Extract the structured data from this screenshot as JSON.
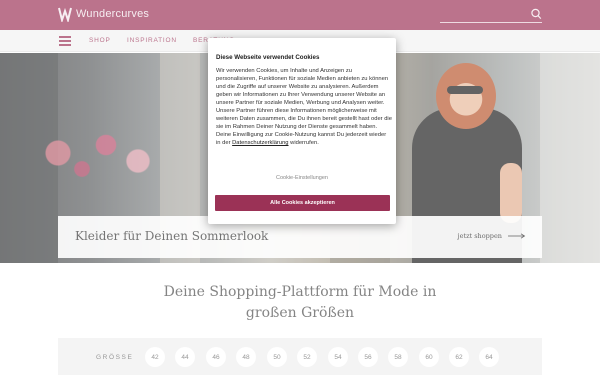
{
  "header": {
    "brand": "Wundercurves",
    "search": {
      "placeholder": "",
      "value": ""
    }
  },
  "nav": {
    "items": [
      "Shop",
      "Inspiration",
      "Beratung"
    ]
  },
  "hero": {
    "title": "Kleider für Deinen Sommerlook",
    "link": "jetzt shoppen"
  },
  "main": {
    "headline_line1": "Deine Shopping-Plattform für Mode in",
    "headline_line2": "großen Größen"
  },
  "sizes": {
    "label": "GRÖSSE",
    "values": [
      "42",
      "44",
      "46",
      "48",
      "50",
      "52",
      "54",
      "56",
      "58",
      "60",
      "62",
      "64"
    ]
  },
  "cookie": {
    "title": "Diese Webseite verwendet Cookies",
    "text_before_link": "Wir verwenden Cookies, um Inhalte und Anzeigen zu personalisieren, Funktionen für soziale Medien anbieten zu können und die Zugriffe auf unserer Website zu analysieren. Außerdem geben wir Informationen zu Ihrer Verwendung unserer Website an unsere Partner für soziale Medien, Werbung und Analysen weiter. Unsere Partner führen diese Informationen möglicherweise mit weiteren Daten zusammen, die Du ihnen bereit gestellt hast oder die sie im Rahmen Deiner Nutzung der Dienste gesammelt haben. Deine Einwilligung zur Cookie-Nutzung kannst Du jederzeit wieder in der ",
    "link": "Datenschutzerklärung",
    "text_after_link": " widerrufen.",
    "settings": "Cookie-Einstellungen",
    "accept": "Alle Cookies akzeptieren"
  },
  "colors": {
    "brand": "#9b3256",
    "nav_bg": "#f2f2f2",
    "size_bar_bg": "#efefef"
  }
}
